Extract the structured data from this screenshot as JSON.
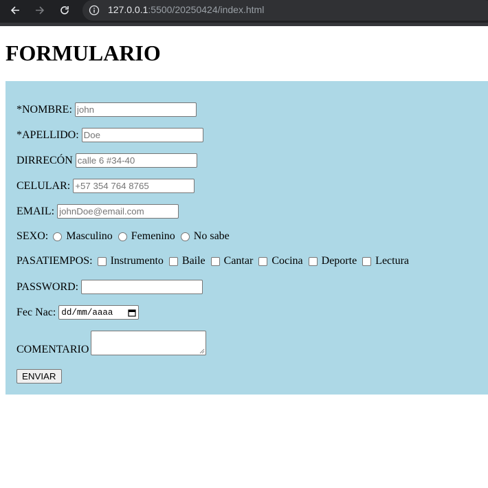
{
  "browser": {
    "url_host": "127.0.0.1",
    "url_path": ":5500/20250424/index.html",
    "chrome_color": "#202124"
  },
  "page": {
    "title": "FORMULARIO",
    "panel_color": "#add8e6"
  },
  "form": {
    "nombre": {
      "label": "*NOMBRE:",
      "placeholder": "john"
    },
    "apellido": {
      "label": "*APELLIDO:",
      "placeholder": "Doe"
    },
    "direccion": {
      "label": "DIRRECÓN",
      "placeholder": "calle 6 #34-40"
    },
    "celular": {
      "label": "CELULAR:",
      "placeholder": "+57 354 764 8765"
    },
    "email": {
      "label": "EMAIL:",
      "placeholder": "johnDoe@email.com"
    },
    "sexo": {
      "label": "SEXO:",
      "options": [
        "Masculino",
        "Femenino",
        "No sabe"
      ]
    },
    "pasatiempos": {
      "label": "PASATIEMPOS:",
      "options": [
        "Instrumento",
        "Baile",
        "Cantar",
        "Cocina",
        "Deporte",
        "Lectura"
      ]
    },
    "password": {
      "label": "PASSWORD:",
      "value": ""
    },
    "fecha": {
      "label": "Fec Nac:",
      "placeholder": "dd/mm/aaaa"
    },
    "comentario": {
      "label": "COMENTARIO"
    },
    "submit_label": "ENVIAR"
  }
}
